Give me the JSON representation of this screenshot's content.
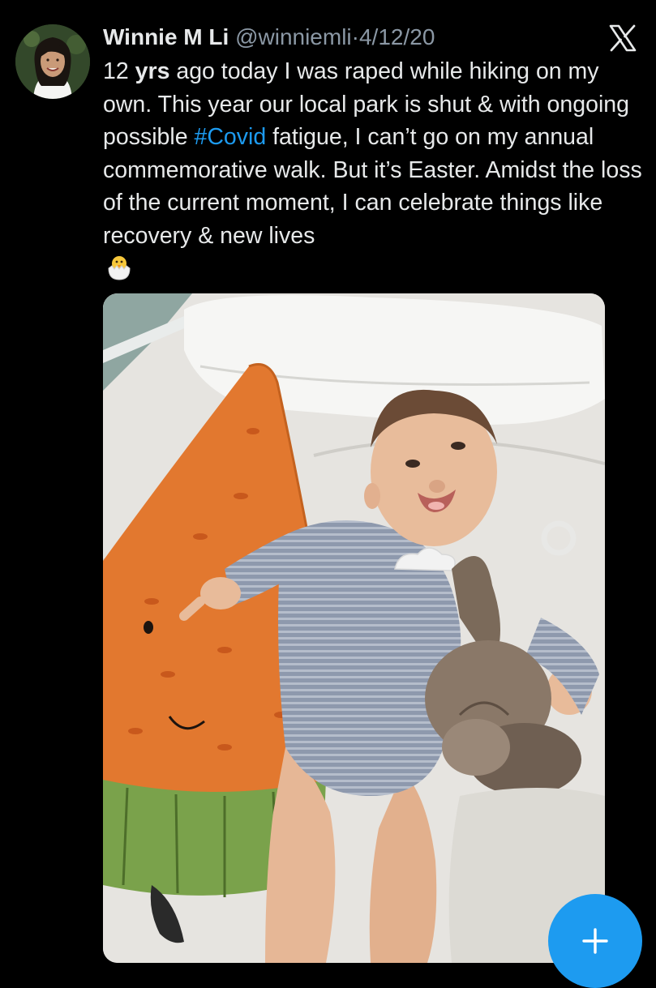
{
  "tweet": {
    "author_name": "Winnie M Li",
    "handle": "@winniemli",
    "separator": "·",
    "date": "4/12/20",
    "text_lead": "12 ",
    "text_bold": "yrs",
    "text_part1": " ago today I was raped while hiking on my own. This year our local park is shut & with ongoing possible ",
    "hashtag": "#Covid",
    "text_part2": " fatigue, I can’t go on my annual commemorative walk. But it’s Easter. Amidst the loss of the current moment, I can celebrate things like recovery & new lives",
    "emoji": "hatching-chick"
  },
  "icons": {
    "platform_logo": "x-logo-icon",
    "compose": "plus-icon"
  },
  "colors": {
    "background": "#000000",
    "text": "#e7e9ea",
    "muted": "#8b98a5",
    "accent": "#1d9bf0"
  }
}
